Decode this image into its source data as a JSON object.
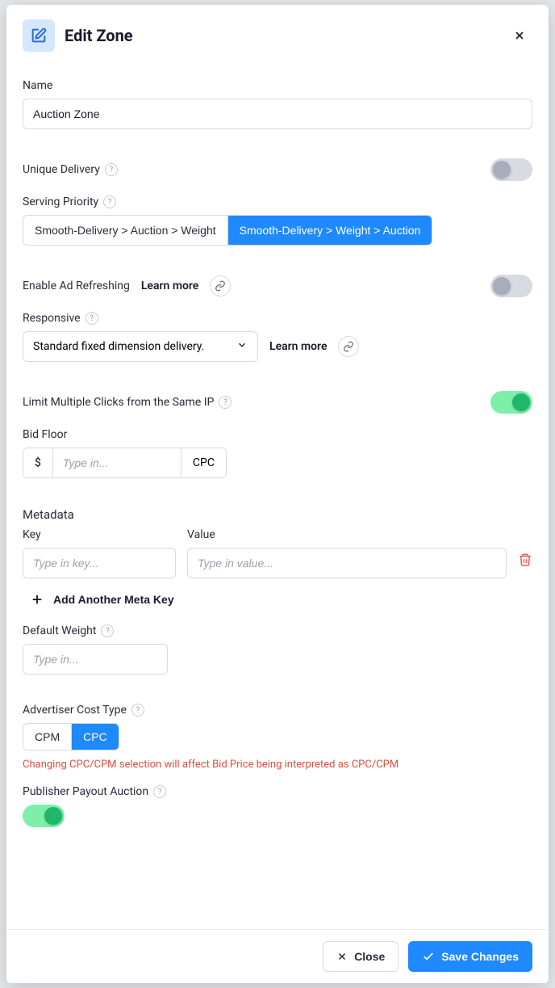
{
  "header": {
    "title": "Edit Zone"
  },
  "nameField": {
    "label": "Name",
    "value": "Auction Zone"
  },
  "uniqueDelivery": {
    "label": "Unique Delivery",
    "on": false
  },
  "servingPriority": {
    "label": "Serving Priority",
    "options": [
      "Smooth-Delivery > Auction > Weight",
      "Smooth-Delivery > Weight > Auction"
    ],
    "activeIndex": 1
  },
  "adRefreshing": {
    "label": "Enable Ad Refreshing",
    "learnMore": "Learn more",
    "on": false
  },
  "responsive": {
    "label": "Responsive",
    "selected": "Standard fixed dimension delivery.",
    "learnMore": "Learn more"
  },
  "limitClicks": {
    "label": "Limit Multiple Clicks from the Same IP",
    "on": true
  },
  "bidFloor": {
    "label": "Bid Floor",
    "currency": "$",
    "placeholder": "Type in...",
    "unit": "CPC"
  },
  "metadata": {
    "heading": "Metadata",
    "keyLabel": "Key",
    "valueLabel": "Value",
    "keyPlaceholder": "Type in key...",
    "valuePlaceholder": "Type in value...",
    "addLabel": "Add Another Meta Key"
  },
  "defaultWeight": {
    "label": "Default Weight",
    "placeholder": "Type in..."
  },
  "costType": {
    "label": "Advertiser Cost Type",
    "options": [
      "CPM",
      "CPC"
    ],
    "activeIndex": 1,
    "warning": "Changing CPC/CPM selection will affect Bid Price being interpreted as CPC/CPM"
  },
  "publisherPayout": {
    "label": "Publisher Payout Auction",
    "on": true
  },
  "footer": {
    "close": "Close",
    "save": "Save Changes"
  }
}
